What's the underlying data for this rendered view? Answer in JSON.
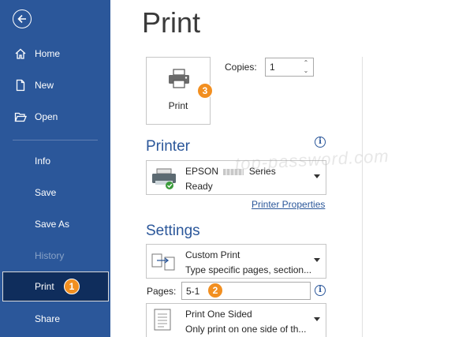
{
  "sidebar": {
    "items": [
      {
        "label": "Home",
        "icon": "home-icon"
      },
      {
        "label": "New",
        "icon": "new-document-icon"
      },
      {
        "label": "Open",
        "icon": "open-folder-icon"
      },
      {
        "label": "Info"
      },
      {
        "label": "Save"
      },
      {
        "label": "Save As"
      },
      {
        "label": "History"
      },
      {
        "label": "Print"
      },
      {
        "label": "Share"
      }
    ]
  },
  "badges": {
    "print_nav": "1",
    "pages": "2",
    "print_button": "3"
  },
  "page": {
    "title": "Print"
  },
  "print_button": {
    "label": "Print"
  },
  "copies": {
    "label": "Copies:",
    "value": "1"
  },
  "printer": {
    "heading": "Printer",
    "name_prefix": "EPSON",
    "name_suffix": "Series",
    "status": "Ready",
    "properties_link": "Printer Properties"
  },
  "settings": {
    "heading": "Settings",
    "print_range": {
      "title": "Custom Print",
      "desc": "Type specific pages, section..."
    },
    "pages": {
      "label": "Pages:",
      "value": "5-1"
    },
    "sides": {
      "title": "Print One Sided",
      "desc": "Only print on one side of th..."
    }
  },
  "watermark": "top-password.com",
  "colors": {
    "accent": "#2b579a",
    "selected": "#0f2d5c",
    "badge": "#f28f20"
  }
}
